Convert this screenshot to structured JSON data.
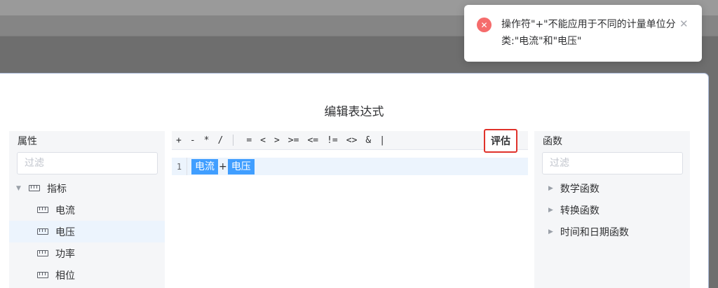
{
  "dialog": {
    "title": "编辑表达式"
  },
  "attributes": {
    "header": "属性",
    "filter_placeholder": "过滤",
    "tree": [
      {
        "label": "指标",
        "level": 0,
        "expanded": true
      },
      {
        "label": "电流",
        "level": 1
      },
      {
        "label": "电压",
        "level": 1,
        "selected": true
      },
      {
        "label": "功率",
        "level": 1
      },
      {
        "label": "相位",
        "level": 1
      }
    ]
  },
  "editor": {
    "operators": [
      "+",
      "-",
      "*",
      "/",
      "=",
      "<",
      ">",
      ">=",
      "<=",
      "!=",
      "<>",
      "&",
      "|"
    ],
    "evaluate_label": "评估",
    "line_number": "1",
    "tokens": [
      "电流",
      "+",
      "电压"
    ]
  },
  "functions": {
    "header": "函数",
    "filter_placeholder": "过滤",
    "items": [
      "数学函数",
      "转换函数",
      "时间和日期函数"
    ]
  },
  "toast": {
    "icon": "error-circle-icon",
    "message": "操作符\"+\"不能应用于不同的计量单位分类:\"电流\"和\"电压\"",
    "close_icon": "close-icon"
  },
  "colors": {
    "token_bg": "#409eff",
    "selected_row": "#ecf4fd",
    "error": "#f56c6c",
    "highlight_border": "#e0322b"
  }
}
